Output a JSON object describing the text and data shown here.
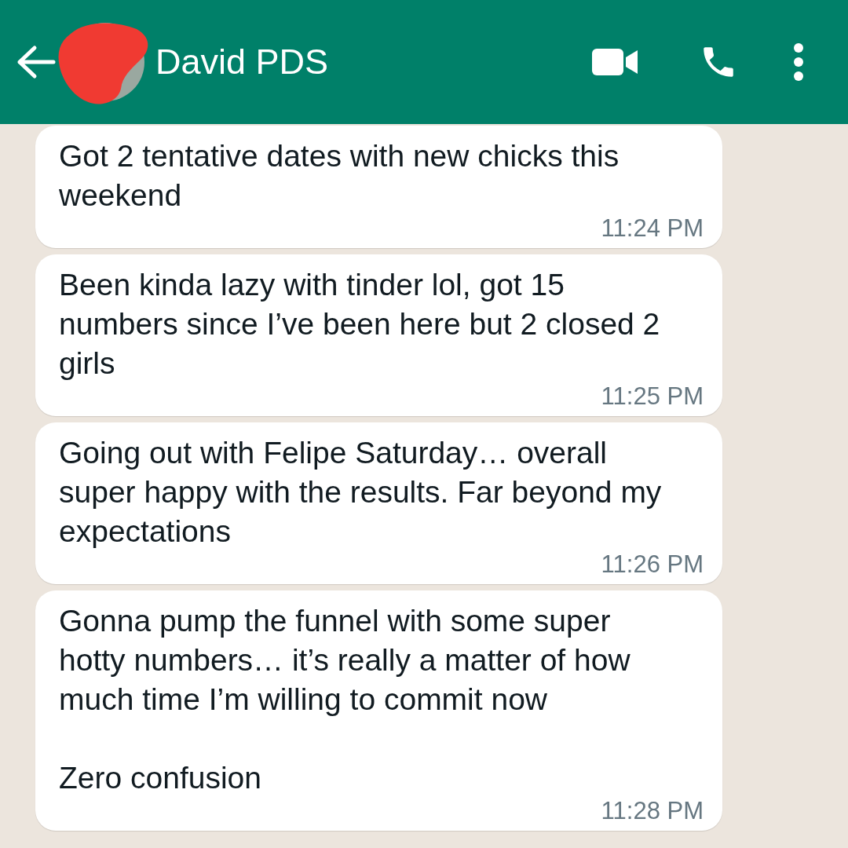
{
  "header": {
    "contact_name": "David PDS"
  },
  "messages": [
    {
      "text": "Got 2 tentative dates with new chicks this weekend",
      "time": "11:24 PM"
    },
    {
      "text": "Been kinda lazy with tinder lol, got 15 numbers since I’ve been here but 2 closed 2 girls",
      "time": "11:25 PM"
    },
    {
      "text": "Going out with Felipe Saturday… overall super happy with the results. Far beyond my expectations",
      "time": "11:26 PM"
    },
    {
      "text": "Gonna pump the funnel with some super hotty numbers… it’s really a matter of how much time I’m willing to commit now\n\nZero confusion",
      "time": "11:28 PM"
    }
  ]
}
